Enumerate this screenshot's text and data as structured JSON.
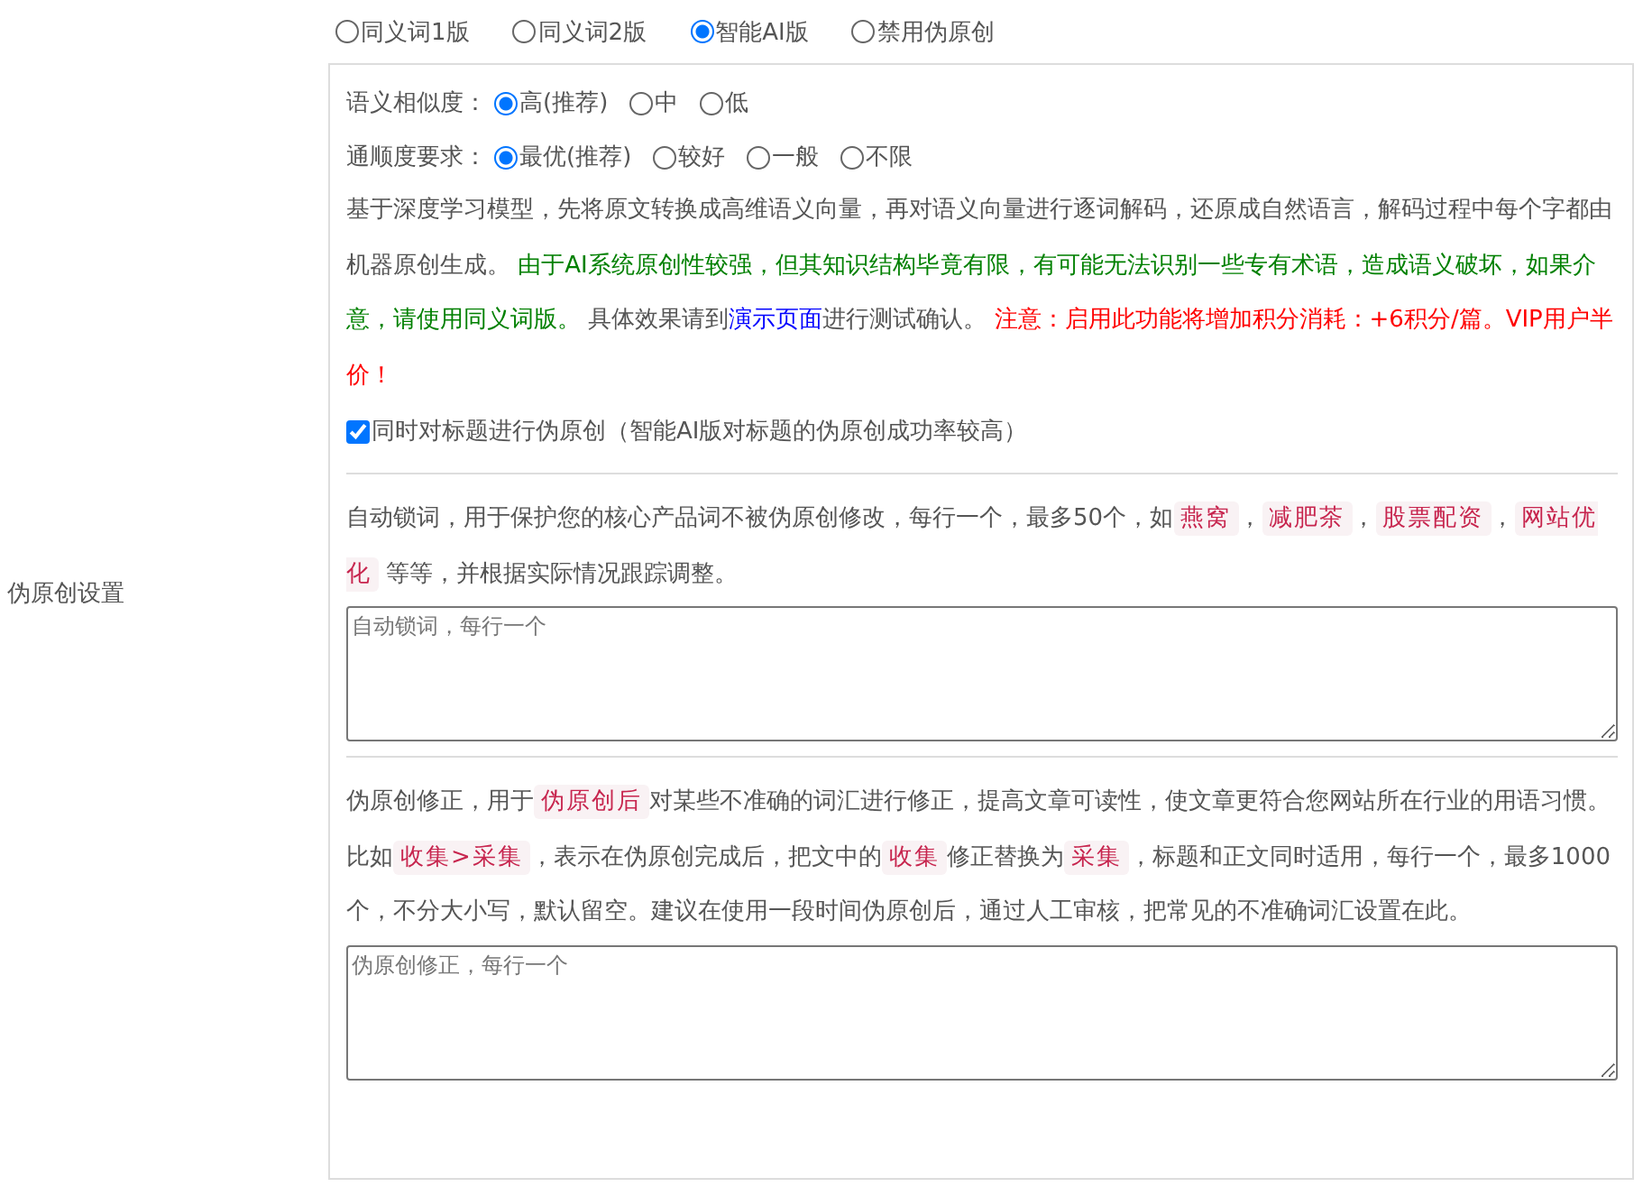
{
  "label": "伪原创设置",
  "modes": [
    {
      "label": "同义词1版",
      "selected": false
    },
    {
      "label": "同义词2版",
      "selected": false
    },
    {
      "label": "智能AI版",
      "selected": true
    },
    {
      "label": "禁用伪原创",
      "selected": false
    }
  ],
  "similarity": {
    "label": "语义相似度：",
    "options": [
      {
        "label": "高(推荐)",
        "selected": true
      },
      {
        "label": "中",
        "selected": false
      },
      {
        "label": "低",
        "selected": false
      }
    ]
  },
  "fluency": {
    "label": "通顺度要求：",
    "options": [
      {
        "label": "最优(推荐)",
        "selected": true
      },
      {
        "label": "较好",
        "selected": false
      },
      {
        "label": "一般",
        "selected": false
      },
      {
        "label": "不限",
        "selected": false
      }
    ]
  },
  "description": [
    {
      "kind": "text",
      "text": "基于深度学习模型，先将原文转换成高维语义向量，再对语义向量进行逐词解码，还原成自然语言，解码过程中每个字都由机器原创生成。 "
    },
    {
      "kind": "green",
      "text": "由于AI系统原创性较强，但其知识结构毕竟有限，有可能无法识别一些专有术语，造成语义破坏，如果介意，请使用同义词版。"
    },
    {
      "kind": "text",
      "text": " 具体效果请到"
    },
    {
      "kind": "link",
      "text": "演示页面"
    },
    {
      "kind": "text",
      "text": "进行测试确认。 "
    },
    {
      "kind": "red",
      "text": "注意：启用此功能将增加积分消耗：+6积分/篇。VIP用户半价！"
    }
  ],
  "title_option": {
    "label": "同时对标题进行伪原创（智能AI版对标题的伪原创成功率较高）",
    "checked": true
  },
  "lock_words": {
    "description": [
      {
        "kind": "text",
        "text": "自动锁词，用于保护您的核心产品词不被伪原创修改，每行一个，最多50个，如"
      },
      {
        "kind": "code",
        "text": "燕窝"
      },
      {
        "kind": "text",
        "text": "，"
      },
      {
        "kind": "code",
        "text": "减肥茶"
      },
      {
        "kind": "text",
        "text": "，"
      },
      {
        "kind": "code",
        "text": "股票配资"
      },
      {
        "kind": "text",
        "text": "，"
      },
      {
        "kind": "code",
        "text": "网站优化"
      },
      {
        "kind": "text",
        "text": " 等等，并根据实际情况跟踪调整。"
      }
    ],
    "placeholder": "自动锁词，每行一个"
  },
  "correction": {
    "description": [
      {
        "kind": "text",
        "text": "伪原创修正，用于"
      },
      {
        "kind": "code",
        "text": "伪原创后"
      },
      {
        "kind": "text",
        "text": "对某些不准确的词汇进行修正，提高文章可读性，使文章更符合您网站所在行业的用语习惯。比如"
      },
      {
        "kind": "code",
        "text": "收集>采集"
      },
      {
        "kind": "text",
        "text": "，表示在伪原创完成后，把文中的"
      },
      {
        "kind": "code",
        "text": "收集"
      },
      {
        "kind": "text",
        "text": "修正替换为"
      },
      {
        "kind": "code",
        "text": "采集"
      },
      {
        "kind": "text",
        "text": "，标题和正文同时适用，每行一个，最多1000个，不分大小写，默认留空。建议在使用一段时间伪原创后，通过人工审核，把常见的不准确词汇设置在此。"
      }
    ],
    "placeholder": "伪原创修正，每行一个"
  }
}
